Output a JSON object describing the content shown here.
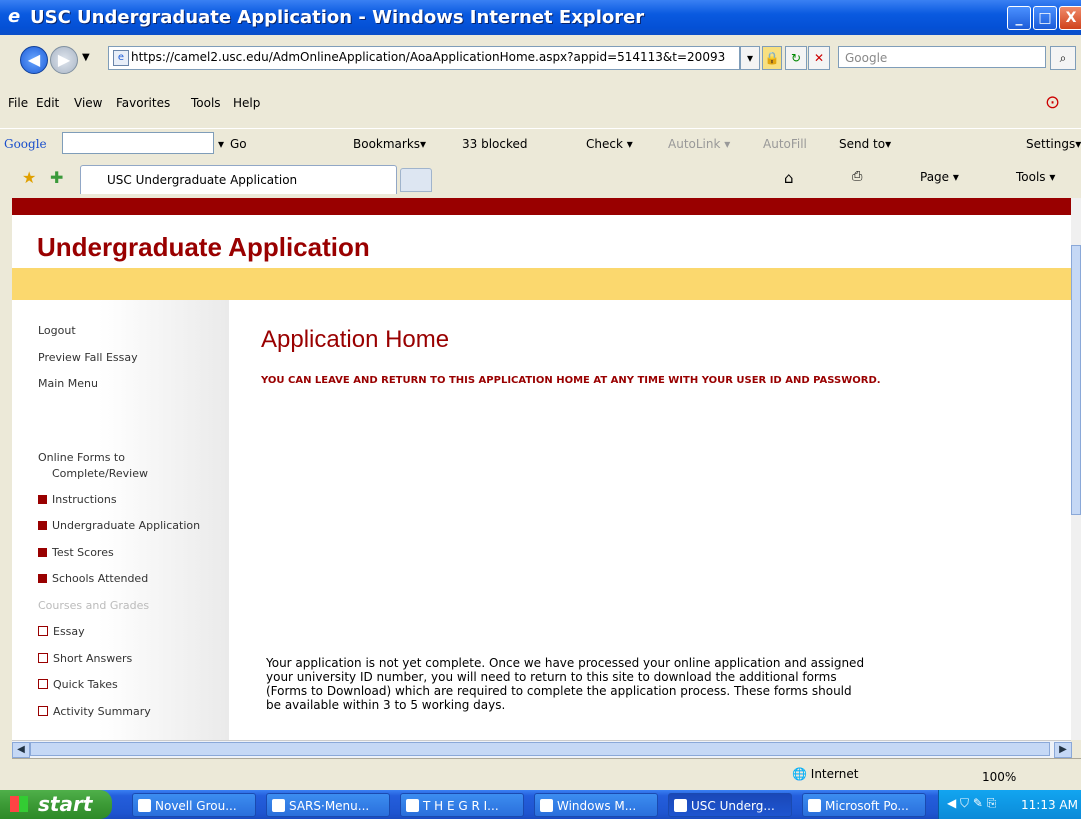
{
  "window": {
    "title": "USC Undergraduate Application - Windows Internet Explorer",
    "controls": [
      "_",
      "□",
      "X"
    ]
  },
  "address": {
    "url": "https://camel2.usc.edu/AdmOnlineApplication/AoaApplicationHome.aspx?appid=514113&t=20093",
    "search_placeholder": "Google"
  },
  "menu": [
    "File",
    "Edit",
    "View",
    "Favorites",
    "Tools",
    "Help"
  ],
  "google_toolbar": {
    "logo": "Google",
    "go": "Go",
    "bookmarks": "Bookmarks▾",
    "blocked": "33 blocked",
    "check": "Check ▾",
    "autolink": "AutoLink ▾",
    "autofill": "AutoFill",
    "sendto": "Send to▾",
    "settings": "Settings▾"
  },
  "tabs": {
    "active": "USC Undergraduate Application",
    "page_menu": "Page ▾",
    "tools_menu": "Tools ▾"
  },
  "page": {
    "header": "Undergraduate Application",
    "heading": "Application Home",
    "notice": "YOU CAN LEAVE AND RETURN TO THIS APPLICATION HOME AT ANY TIME WITH YOUR USER ID AND PASSWORD.",
    "paragraph": "Your application is not yet complete. Once we have processed your online application and assigned your university ID number, you will need to return to this site to download the additional forms (Forms to Download) which are required to complete the application process. These forms should be available within 3 to 5 working days."
  },
  "sidebar": {
    "links": [
      "Logout",
      "Preview Fall Essay",
      "Main Menu"
    ],
    "section_title_1": "Online Forms to",
    "section_title_2": "Complete/Review",
    "items": [
      {
        "label": "Instructions",
        "state": "filled"
      },
      {
        "label": "Undergraduate Application",
        "state": "filled"
      },
      {
        "label": "Test Scores",
        "state": "filled"
      },
      {
        "label": "Schools Attended",
        "state": "filled"
      },
      {
        "label": "Courses and Grades",
        "state": "disabled"
      },
      {
        "label": "Essay",
        "state": "empty"
      },
      {
        "label": "Short Answers",
        "state": "empty"
      },
      {
        "label": "Quick Takes",
        "state": "empty"
      },
      {
        "label": "Activity Summary",
        "state": "empty"
      }
    ]
  },
  "status": {
    "zone": "Internet",
    "zoom": "100%"
  },
  "taskbar": {
    "start": "start",
    "buttons": [
      "Novell Grou...",
      "SARS·Menu...",
      "T H E  G R I...",
      "Windows M...",
      "USC Underg...",
      "Microsoft Po..."
    ],
    "clock": "11:13 AM"
  },
  "colors": {
    "brand_red": "#990000",
    "band_yellow": "#fbd86e"
  }
}
